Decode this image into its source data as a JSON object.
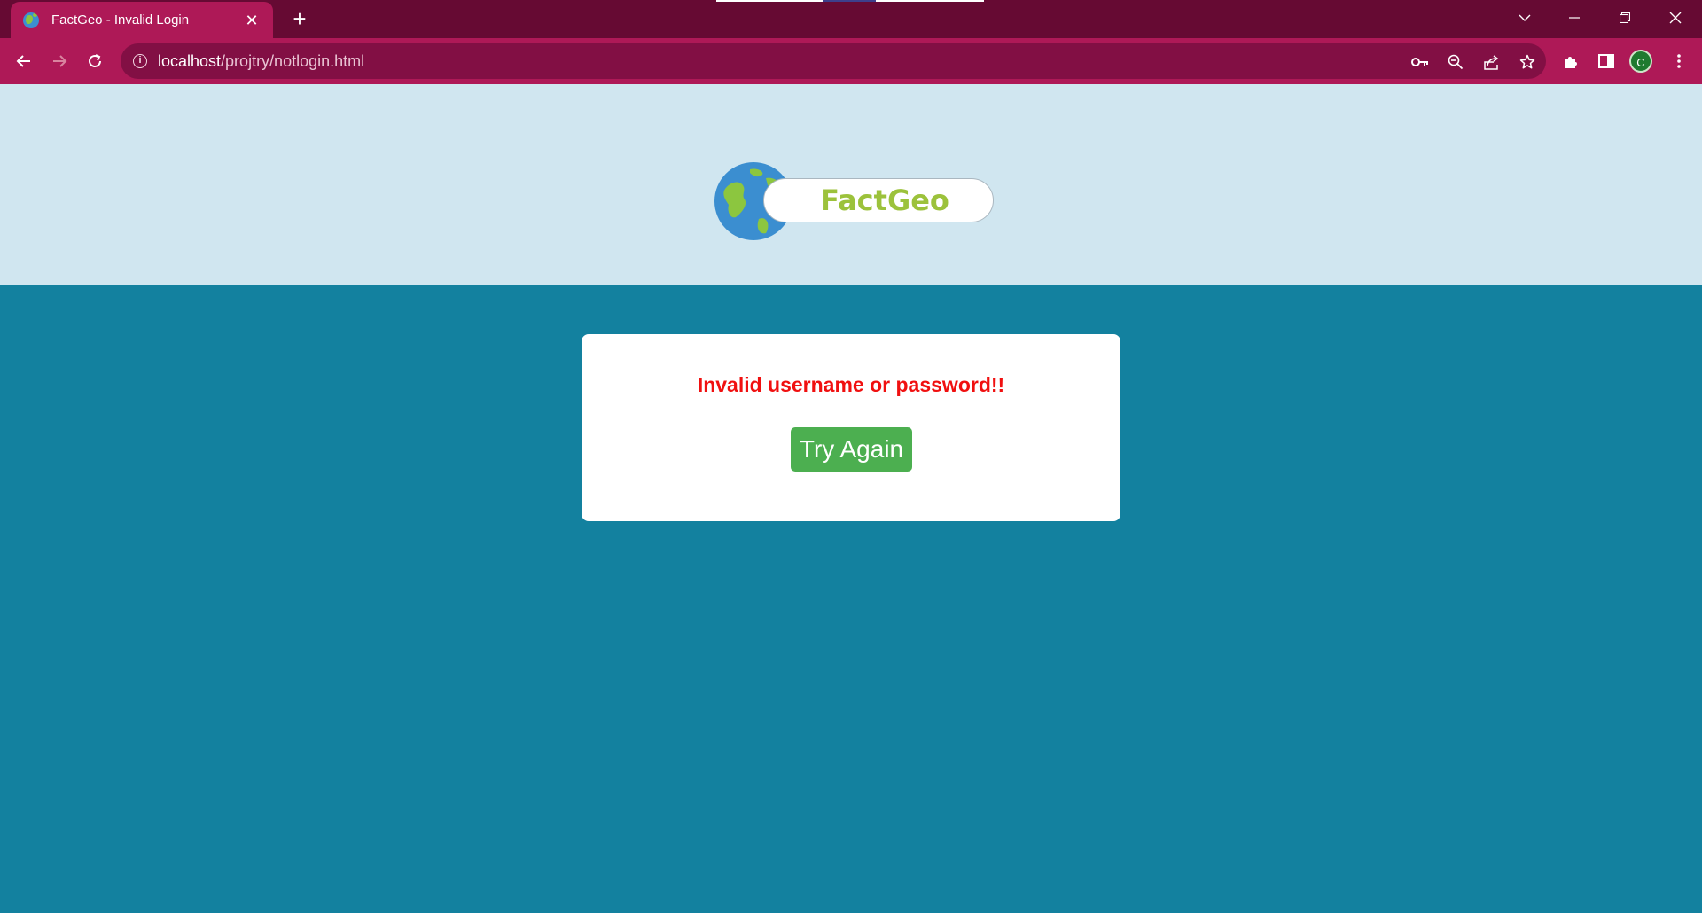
{
  "browser": {
    "tab": {
      "title": "FactGeo - Invalid Login",
      "close_label": "✕",
      "favicon": "globe-icon"
    },
    "new_tab_label": "+",
    "window_controls": {
      "dropdown": "chevron-down-icon",
      "minimize": "minimize-icon",
      "restore": "restore-icon",
      "close": "close-icon"
    },
    "address_bar": {
      "host": "localhost",
      "path": "/projtry/notlogin.html"
    },
    "profile_initial": "C",
    "toolbar_icons": [
      "back-arrow-icon",
      "forward-arrow-icon",
      "reload-icon",
      "info-icon",
      "key-icon",
      "zoom-out-icon",
      "share-icon",
      "star-icon",
      "puzzle-icon",
      "side-panel-icon",
      "menu-icon"
    ],
    "colors": {
      "tabbar": "#660a33",
      "active_tab": "#ae1957",
      "omnibox": "#820f44"
    }
  },
  "header": {
    "logo_text": "FactGeo",
    "logo_icon": "globe-icon",
    "colors": {
      "background": "#d0e6f0",
      "logo_text": "#9cc23b"
    }
  },
  "main": {
    "error_message": "Invalid username or password!!",
    "try_again_label": "Try Again",
    "colors": {
      "background": "#13819f",
      "error": "#f01010",
      "button": "#4caf50"
    }
  }
}
